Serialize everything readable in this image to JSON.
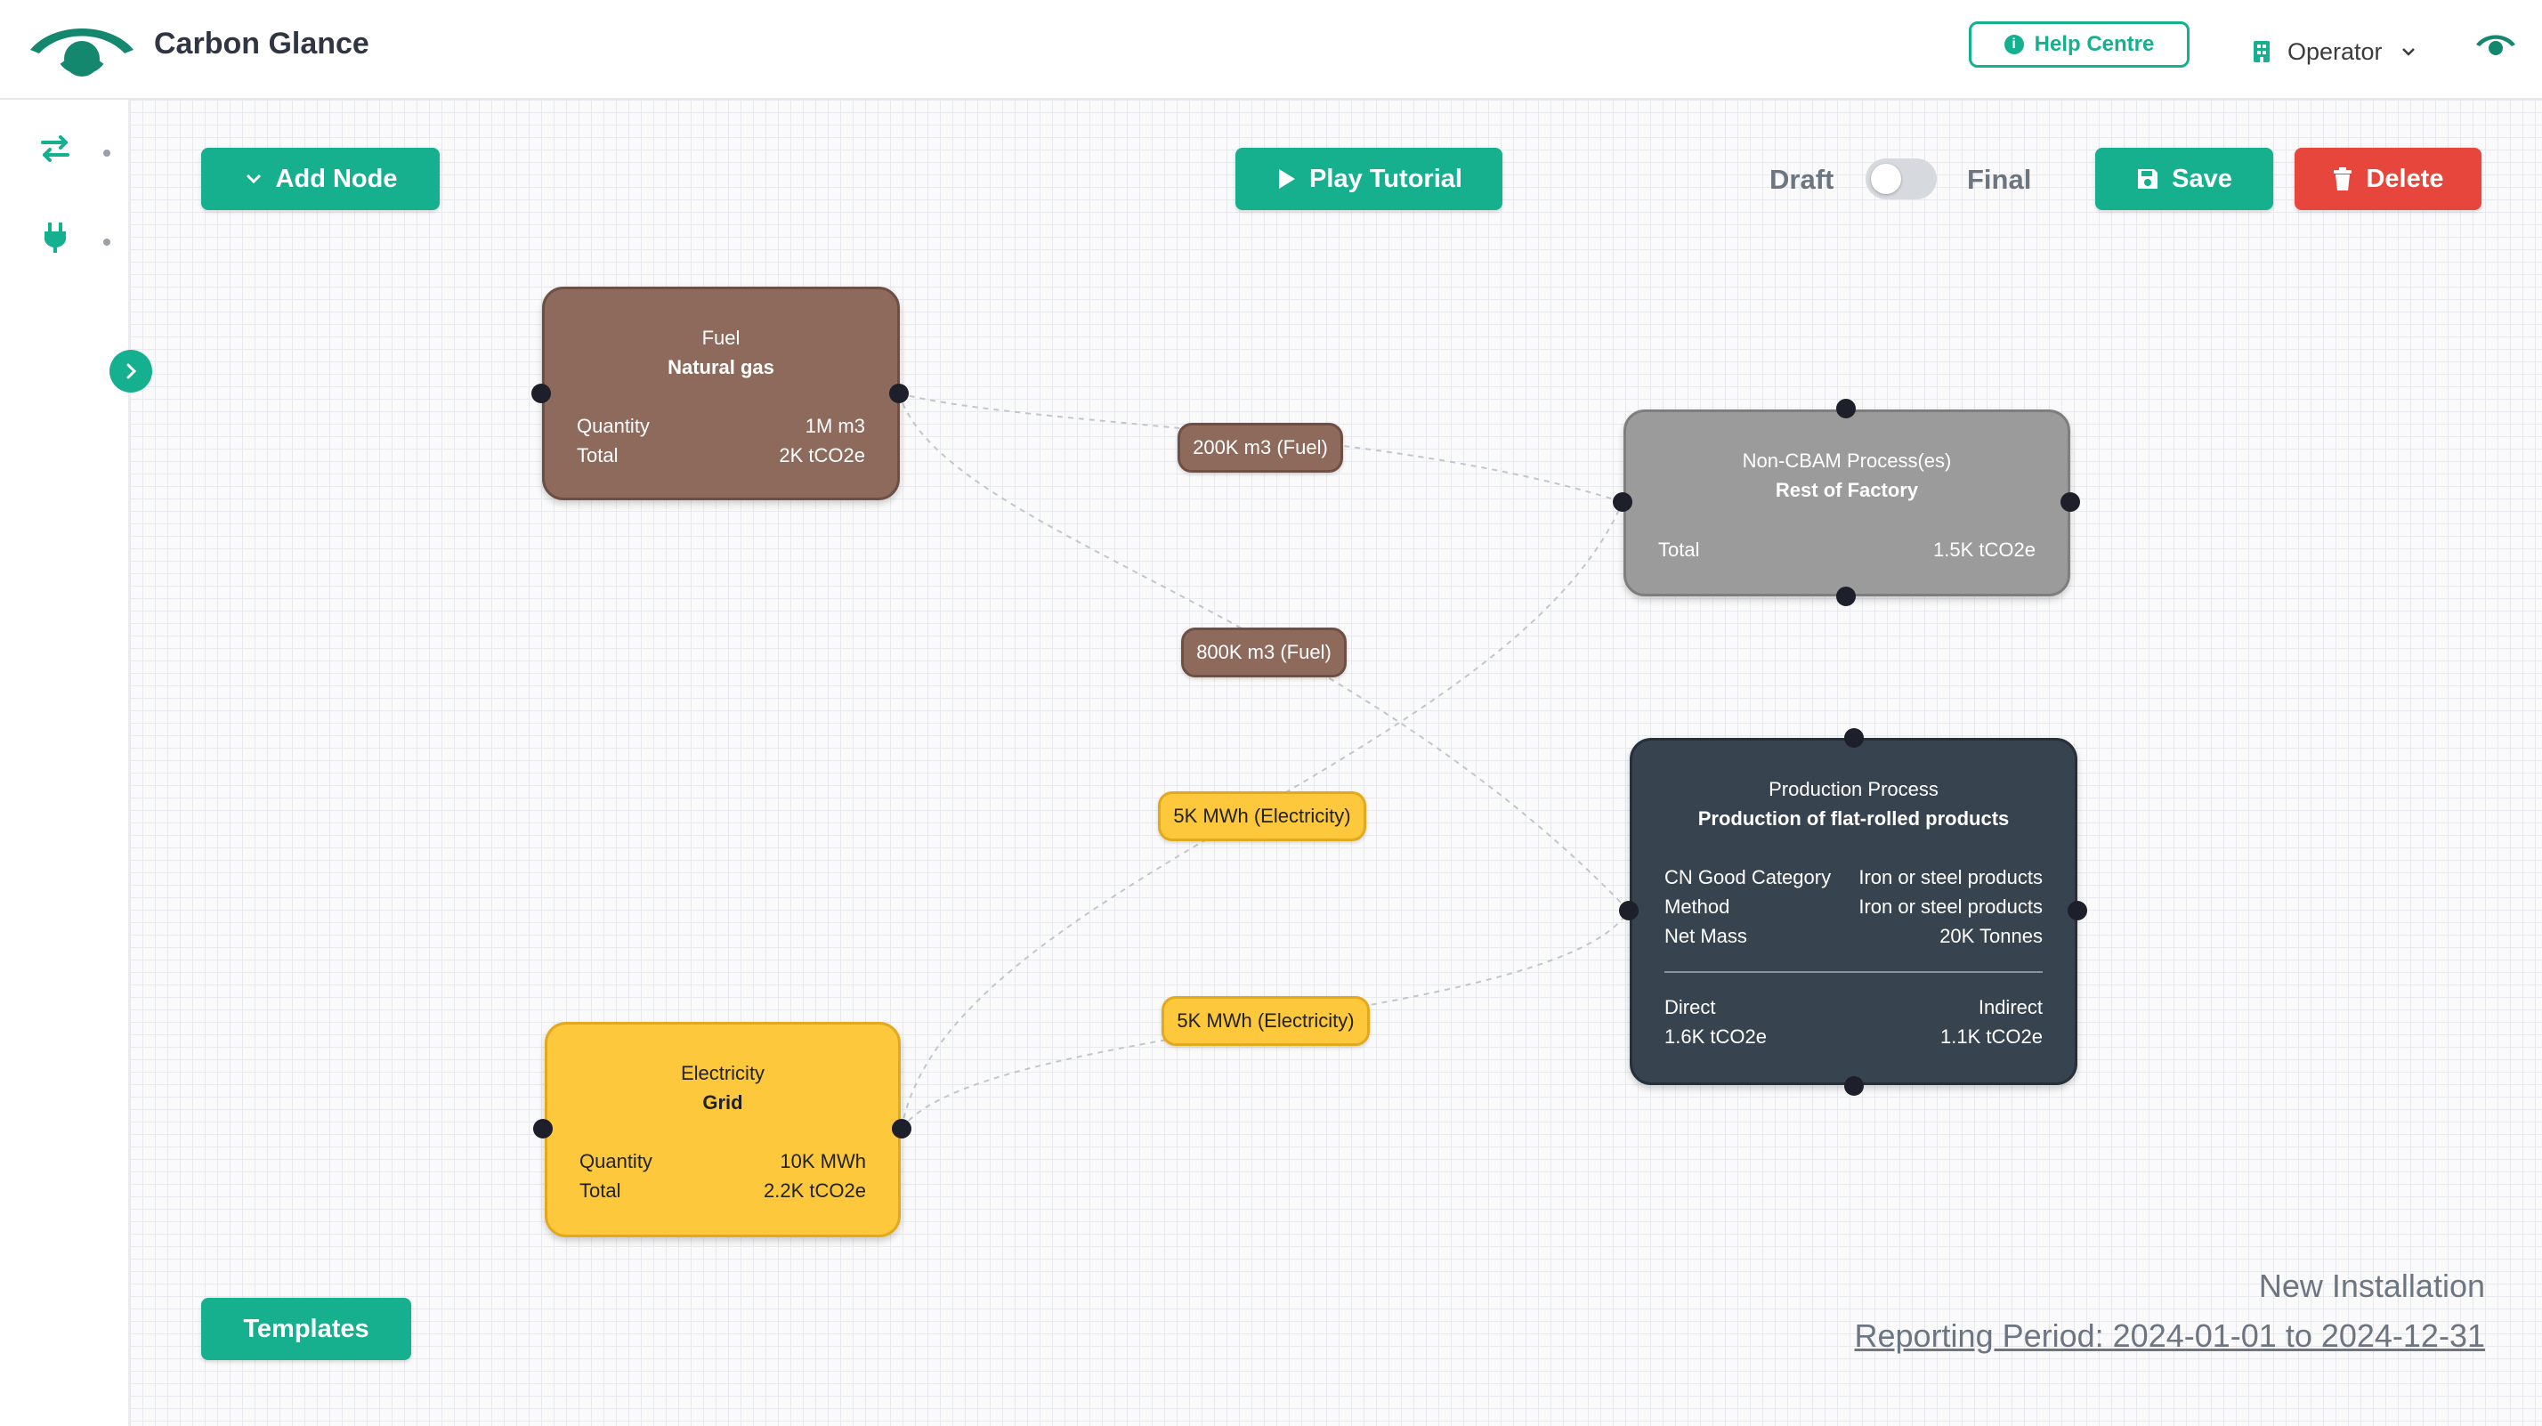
{
  "header": {
    "app_title": "Carbon Glance",
    "help_label": "Help Centre",
    "role_label": "Operator",
    "logo_icon": "eye-logo-icon",
    "accent_color": "#14b08f"
  },
  "sidebar": {
    "items": [
      {
        "icon": "swap-arrows-icon"
      },
      {
        "icon": "plug-icon"
      }
    ]
  },
  "toolbar": {
    "add_node_label": "Add Node",
    "play_tutorial_label": "Play Tutorial",
    "draft_label": "Draft",
    "final_label": "Final",
    "toggle_state": "Draft",
    "save_label": "Save",
    "delete_label": "Delete",
    "templates_label": "Templates"
  },
  "nodes": {
    "fuel": {
      "type": "Fuel",
      "name": "Natural gas",
      "rows": [
        {
          "label": "Quantity",
          "value": "1M m3"
        },
        {
          "label": "Total",
          "value": "2K tCO2e"
        }
      ],
      "color": "#8e6a5d"
    },
    "noncbam": {
      "type": "Non-CBAM Process(es)",
      "name": "Rest of Factory",
      "rows": [
        {
          "label": "Total",
          "value": "1.5K tCO2e"
        }
      ],
      "color": "#9b9b9b"
    },
    "production": {
      "type": "Production Process",
      "name": "Production of flat-rolled products",
      "rows": [
        {
          "label": "CN Good Category",
          "value": "Iron or steel products"
        },
        {
          "label": "Method",
          "value": "Iron or steel products"
        },
        {
          "label": "Net Mass",
          "value": "20K Tonnes"
        }
      ],
      "direct_label": "Direct",
      "direct_value": "1.6K tCO2e",
      "indirect_label": "Indirect",
      "indirect_value": "1.1K tCO2e",
      "color": "#37434f"
    },
    "electricity": {
      "type": "Electricity",
      "name": "Grid",
      "rows": [
        {
          "label": "Quantity",
          "value": "10K MWh"
        },
        {
          "label": "Total",
          "value": "2.2K tCO2e"
        }
      ],
      "color": "#fdc83b"
    }
  },
  "edges": [
    {
      "label": "200K m3 (Fuel)"
    },
    {
      "label": "800K m3 (Fuel)"
    },
    {
      "label": "5K MWh (Electricity)"
    },
    {
      "label": "5K MWh (Electricity)"
    }
  ],
  "footer": {
    "installation_name": "New Installation",
    "reporting_period": "Reporting Period: 2024-01-01 to 2024-12-31"
  }
}
